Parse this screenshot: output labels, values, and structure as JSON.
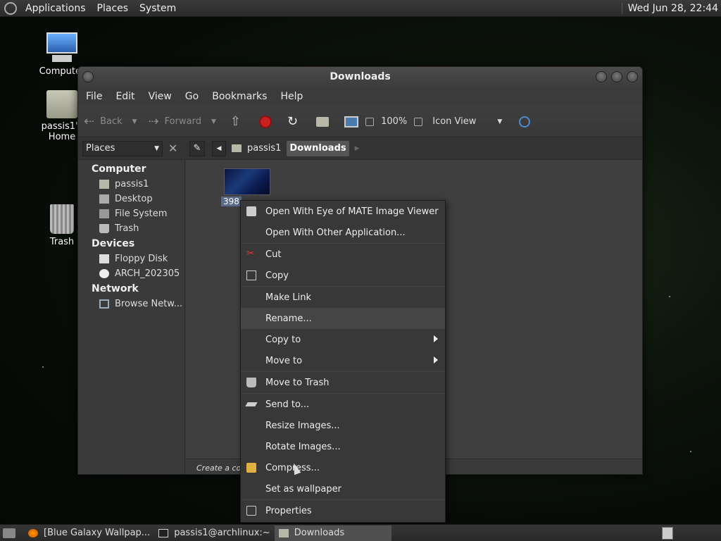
{
  "top_panel": {
    "menus": [
      "Applications",
      "Places",
      "System"
    ],
    "clock": "Wed Jun 28, 22:44"
  },
  "desktop": {
    "icons": [
      {
        "label": "Computer",
        "icon": "computer-icon"
      },
      {
        "label": "passis1's Home",
        "icon": "home-folder-icon"
      },
      {
        "label": "Trash",
        "icon": "trash-icon"
      }
    ]
  },
  "window": {
    "title": "Downloads",
    "menubar": [
      "File",
      "Edit",
      "View",
      "Go",
      "Bookmarks",
      "Help"
    ],
    "toolbar": {
      "back": "Back",
      "forward": "Forward",
      "zoom": "100%",
      "view_mode": "Icon View"
    },
    "sidebar_selector": "Places",
    "breadcrumbs": [
      "passis1",
      "Downloads"
    ],
    "sidebar": {
      "computer_header": "Computer",
      "computer_items": [
        "passis1",
        "Desktop",
        "File System",
        "Trash"
      ],
      "devices_header": "Devices",
      "devices_items": [
        "Floppy Disk",
        "ARCH_202305"
      ],
      "network_header": "Network",
      "network_items": [
        "Browse Netw..."
      ]
    },
    "file": {
      "label": "398"
    },
    "status": "Create a co"
  },
  "context_menu": {
    "items": [
      "Open With Eye of MATE Image Viewer",
      "Open With Other Application...",
      "Cut",
      "Copy",
      "Make Link",
      "Rename...",
      "Copy to",
      "Move to",
      "Move to Trash",
      "Send to...",
      "Resize Images...",
      "Rotate Images...",
      "Compress...",
      "Set as wallpaper",
      "Properties"
    ]
  },
  "bottom_panel": {
    "tasks": [
      "[Blue Galaxy Wallpap...",
      "passis1@archlinux:~",
      "Downloads"
    ]
  },
  "colors": {
    "accent": "#5a6a8a",
    "panel": "#2b2b2b"
  }
}
